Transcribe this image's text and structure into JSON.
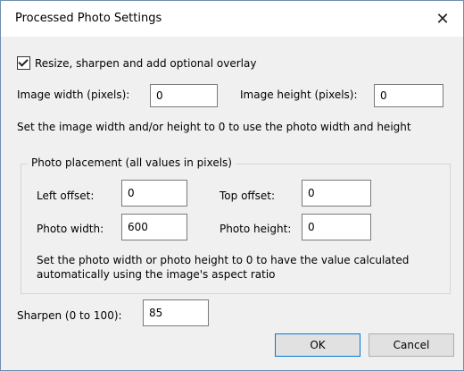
{
  "window": {
    "title": "Processed Photo Settings",
    "close_glyph": "✕"
  },
  "options": {
    "resize_checkbox": {
      "label": "Resize, sharpen and add optional overlay",
      "checked": true
    }
  },
  "image": {
    "width_label": "Image width (pixels):",
    "width_value": "0",
    "height_label": "Image height (pixels):",
    "height_value": "0",
    "hint": "Set the image width and/or height to 0 to use the photo width and height"
  },
  "placement": {
    "group_label": "Photo placement (all values in pixels)",
    "left_label": "Left offset:",
    "left_value": "0",
    "top_label": "Top offset:",
    "top_value": "0",
    "photo_width_label": "Photo width:",
    "photo_width_value": "600",
    "photo_height_label": "Photo height:",
    "photo_height_value": "0",
    "hint_line1": "Set the photo width or photo height to 0 to have the value calculated",
    "hint_line2": "automatically using the image's aspect ratio"
  },
  "sharpen": {
    "label": "Sharpen (0 to 100):",
    "value": "85"
  },
  "buttons": {
    "ok": "OK",
    "cancel": "Cancel"
  }
}
